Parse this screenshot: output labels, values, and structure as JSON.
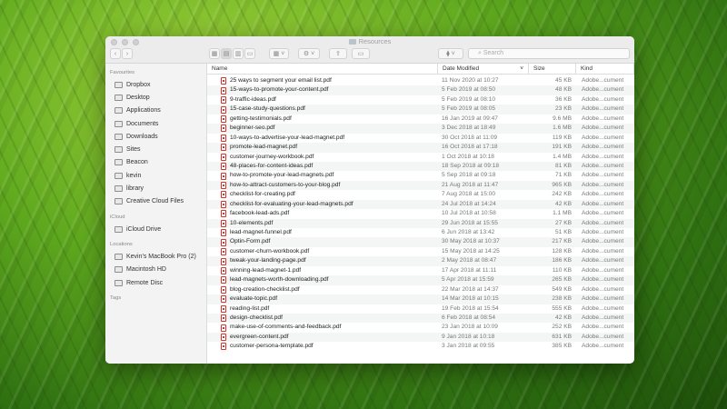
{
  "window": {
    "title": "Resources",
    "search_placeholder": "Search"
  },
  "sidebar": {
    "favourites_label": "Favourites",
    "favourites": [
      {
        "label": "Dropbox",
        "icon": "dropbox-icon"
      },
      {
        "label": "Desktop",
        "icon": "desktop-icon"
      },
      {
        "label": "Applications",
        "icon": "applications-icon"
      },
      {
        "label": "Documents",
        "icon": "documents-icon"
      },
      {
        "label": "Downloads",
        "icon": "downloads-icon"
      },
      {
        "label": "Sites",
        "icon": "folder-icon"
      },
      {
        "label": "Beacon",
        "icon": "folder-icon"
      },
      {
        "label": "kevin",
        "icon": "home-icon"
      },
      {
        "label": "library",
        "icon": "folder-icon"
      },
      {
        "label": "Creative Cloud Files",
        "icon": "folder-icon"
      }
    ],
    "icloud_label": "iCloud",
    "icloud": [
      {
        "label": "iCloud Drive",
        "icon": "cloud-icon"
      }
    ],
    "locations_label": "Locations",
    "locations": [
      {
        "label": "Kevin's MacBook Pro (2)",
        "icon": "laptop-icon"
      },
      {
        "label": "Macintosh HD",
        "icon": "disk-icon"
      },
      {
        "label": "Remote Disc",
        "icon": "disc-icon"
      }
    ],
    "tags_label": "Tags"
  },
  "columns": {
    "name": "Name",
    "date": "Date Modified",
    "size": "Size",
    "kind": "Kind"
  },
  "files": [
    [
      "25 ways to segment your email list.pdf",
      "11 Nov 2020 at 10:27",
      "45 KB",
      "Adobe...cument"
    ],
    [
      "15-ways-to-promote-your-content.pdf",
      "5 Feb 2019 at 08:50",
      "48 KB",
      "Adobe...cument"
    ],
    [
      "9-traffic-ideas.pdf",
      "5 Feb 2019 at 08:10",
      "36 KB",
      "Adobe...cument"
    ],
    [
      "15-case-study-questions.pdf",
      "5 Feb 2019 at 08:05",
      "23 KB",
      "Adobe...cument"
    ],
    [
      "getting-testimonials.pdf",
      "16 Jan 2019 at 09:47",
      "9.6 MB",
      "Adobe...cument"
    ],
    [
      "beginner-seo.pdf",
      "3 Dec 2018 at 18:49",
      "1.6 MB",
      "Adobe...cument"
    ],
    [
      "10-ways-to-advertise-your-lead-magnet.pdf",
      "30 Oct 2018 at 11:09",
      "119 KB",
      "Adobe...cument"
    ],
    [
      "promote-lead-magnet.pdf",
      "16 Oct 2018 at 17:18",
      "191 KB",
      "Adobe...cument"
    ],
    [
      "customer-journey-workbook.pdf",
      "1 Oct 2018 at 10:18",
      "1.4 MB",
      "Adobe...cument"
    ],
    [
      "48-places-for-content-ideas.pdf",
      "18 Sep 2018 at 09:18",
      "81 KB",
      "Adobe...cument"
    ],
    [
      "how-to-promote-your-lead-magnets.pdf",
      "5 Sep 2018 at 09:18",
      "71 KB",
      "Adobe...cument"
    ],
    [
      "how-to-attract-customers-to-your-blog.pdf",
      "21 Aug 2018 at 11:47",
      "965 KB",
      "Adobe...cument"
    ],
    [
      "checklist-for-creating.pdf",
      "7 Aug 2018 at 15:00",
      "242 KB",
      "Adobe...cument"
    ],
    [
      "checklist-for-evaluating-your-lead-magnets.pdf",
      "24 Jul 2018 at 14:24",
      "42 KB",
      "Adobe...cument"
    ],
    [
      "facebook-lead-ads.pdf",
      "10 Jul 2018 at 10:58",
      "1.1 MB",
      "Adobe...cument"
    ],
    [
      "10-elements.pdf",
      "29 Jun 2018 at 15:55",
      "27 KB",
      "Adobe...cument"
    ],
    [
      "lead-magnet-funnel.pdf",
      "6 Jun 2018 at 13:42",
      "51 KB",
      "Adobe...cument"
    ],
    [
      "Optin-Form.pdf",
      "30 May 2018 at 10:37",
      "217 KB",
      "Adobe...cument"
    ],
    [
      "customer-churn-workbook.pdf",
      "15 May 2018 at 14:25",
      "128 KB",
      "Adobe...cument"
    ],
    [
      "tweak-your-landing-page.pdf",
      "2 May 2018 at 08:47",
      "186 KB",
      "Adobe...cument"
    ],
    [
      "winning-lead-magnet-1.pdf",
      "17 Apr 2018 at 11:11",
      "110 KB",
      "Adobe...cument"
    ],
    [
      "lead-magnets-worth-downloading.pdf",
      "5 Apr 2018 at 15:59",
      "265 KB",
      "Adobe...cument"
    ],
    [
      "blog-creation-checklist.pdf",
      "22 Mar 2018 at 14:37",
      "549 KB",
      "Adobe...cument"
    ],
    [
      "evaluate-topic.pdf",
      "14 Mar 2018 at 10:15",
      "238 KB",
      "Adobe...cument"
    ],
    [
      "reading-list.pdf",
      "19 Feb 2018 at 15:54",
      "555 KB",
      "Adobe...cument"
    ],
    [
      "design-checklist.pdf",
      "6 Feb 2018 at 08:54",
      "42 KB",
      "Adobe...cument"
    ],
    [
      "make-use-of-comments-and-feedback.pdf",
      "23 Jan 2018 at 10:09",
      "252 KB",
      "Adobe...cument"
    ],
    [
      "evergreen-content.pdf",
      "9 Jan 2018 at 10:18",
      "631 KB",
      "Adobe...cument"
    ],
    [
      "customer-persona-template.pdf",
      "3 Jan 2018 at 09:55",
      "385 KB",
      "Adobe...cument"
    ]
  ]
}
